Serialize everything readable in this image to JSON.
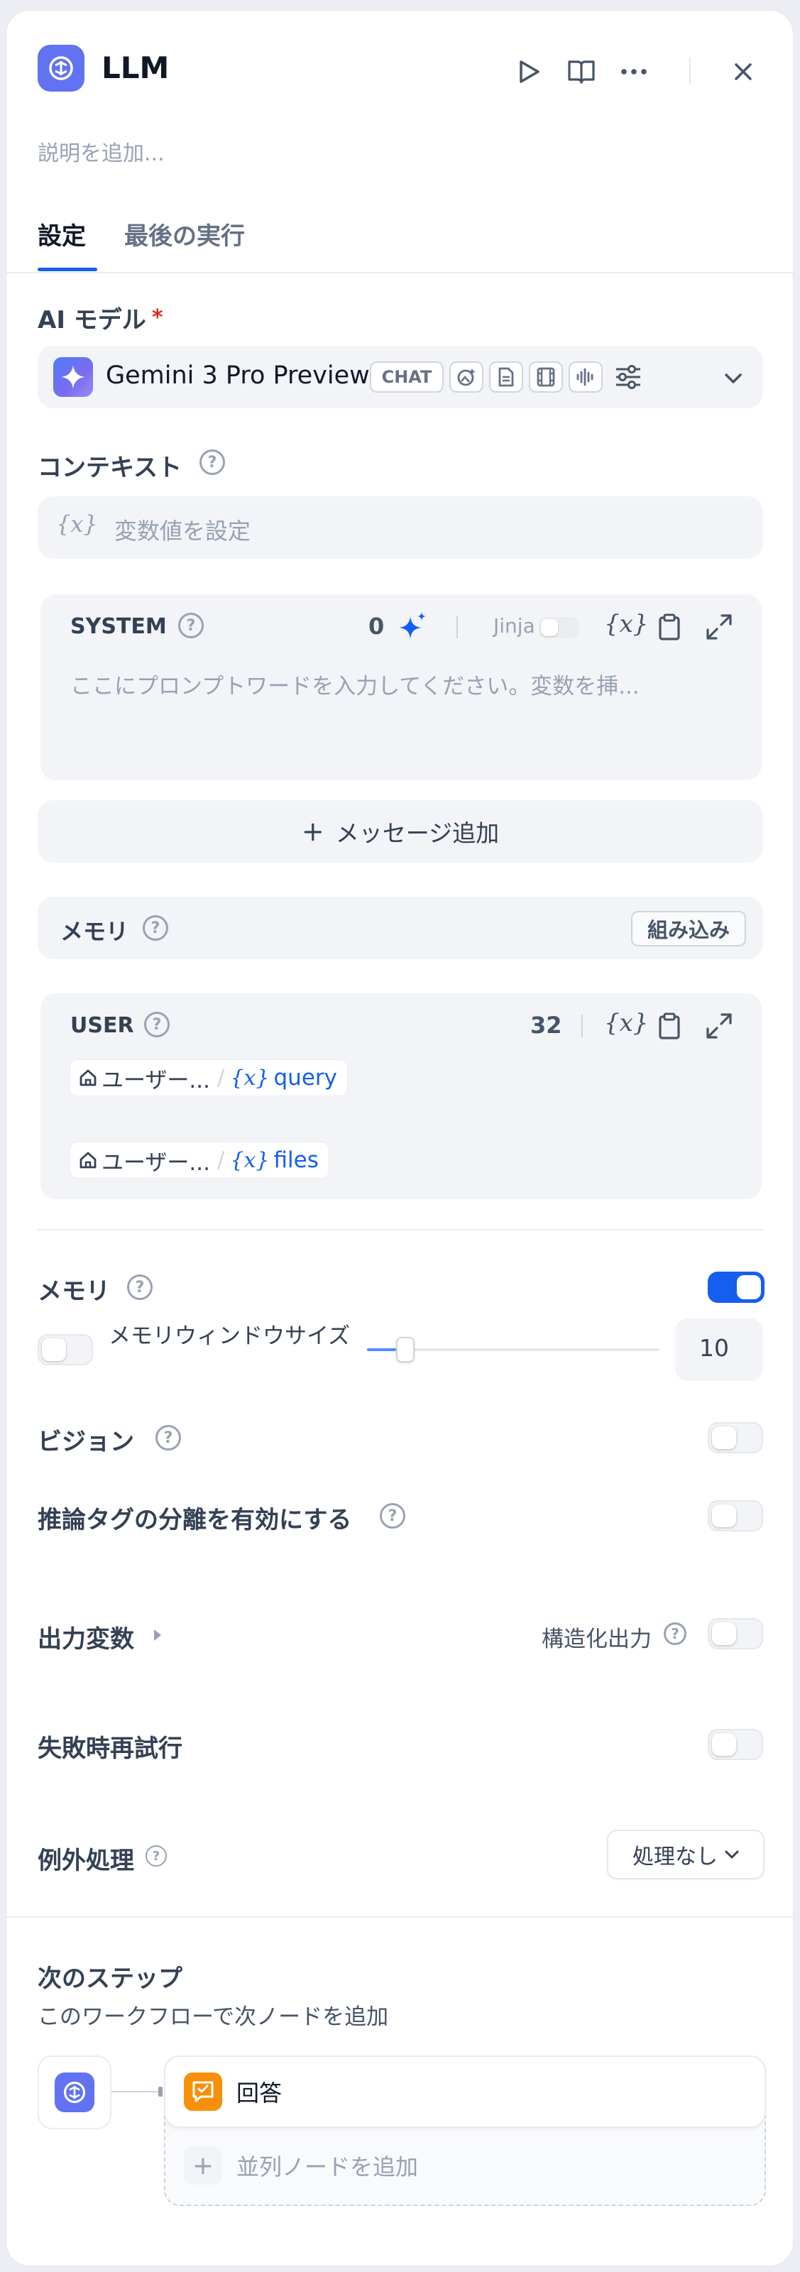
{
  "header": {
    "title": "LLM",
    "description_placeholder": "説明を追加..."
  },
  "tabs": [
    {
      "label": "設定",
      "active": true
    },
    {
      "label": "最後の実行",
      "active": false
    }
  ],
  "model": {
    "section_label": "AI モデル",
    "required_mark": "*",
    "name": "Gemini 3 Pro Preview",
    "mode_badge": "CHAT"
  },
  "context": {
    "label": "コンテキスト",
    "placeholder": "変数値を設定",
    "var_icon": "{x}"
  },
  "system_prompt": {
    "role": "SYSTEM",
    "token_count": "0",
    "jinja_label": "Jinja",
    "placeholder": "ここにプロンプトワードを入力してください。変数を挿..."
  },
  "add_message_label": "メッセージ追加",
  "memory_block": {
    "label": "メモリ",
    "badge": "組み込み"
  },
  "user_prompt": {
    "role": "USER",
    "token_count": "32",
    "vars": [
      {
        "node": "ユーザー...",
        "var": "query"
      },
      {
        "node": "ユーザー...",
        "var": "files"
      }
    ]
  },
  "memory_settings": {
    "label": "メモリ",
    "enabled": true,
    "window_label": "メモリウィンドウサイズ",
    "window_enabled": false,
    "window_value": "10",
    "slider_fraction": 0.1
  },
  "vision": {
    "label": "ビジョン",
    "enabled": false
  },
  "reasoning": {
    "label": "推論タグの分離を有効にする",
    "enabled": false
  },
  "output": {
    "label": "出力変数",
    "structured_label": "構造化出力",
    "structured_enabled": false
  },
  "retry": {
    "label": "失敗時再試行",
    "enabled": false
  },
  "exception": {
    "label": "例外処理",
    "value": "処理なし"
  },
  "next_step": {
    "title": "次のステップ",
    "subtitle": "このワークフローで次ノードを追加",
    "node_label": "回答",
    "add_parallel_label": "並列ノードを追加"
  },
  "colors": {
    "accent": "#155eef",
    "llm_icon": "#6172f3",
    "answer_icon": "#f79009",
    "required": "#d92d20"
  }
}
